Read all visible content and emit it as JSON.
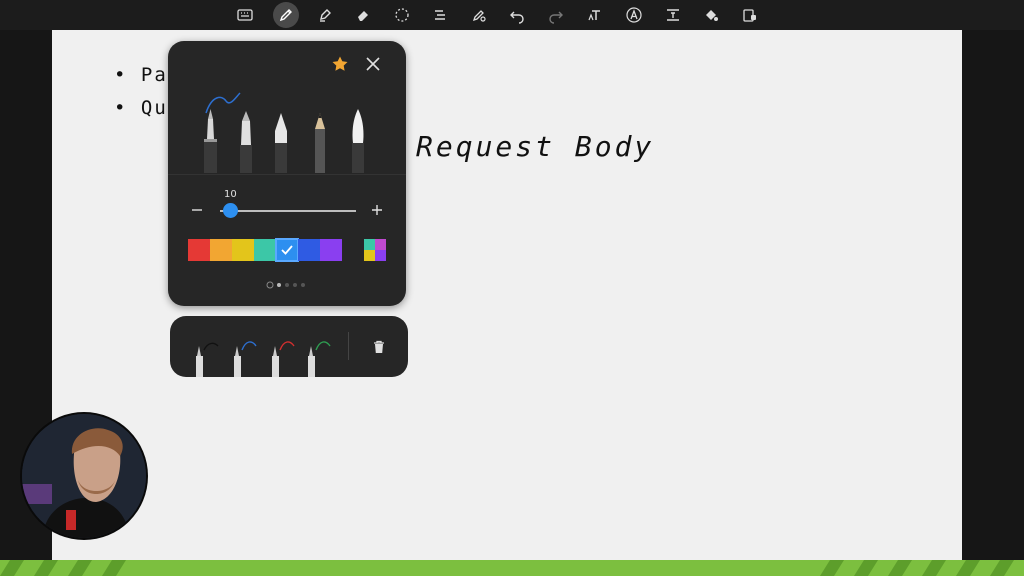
{
  "toolbar": {
    "tools": [
      {
        "name": "keyboard-icon"
      },
      {
        "name": "pen-icon",
        "active": true
      },
      {
        "name": "highlighter-icon"
      },
      {
        "name": "eraser-icon"
      },
      {
        "name": "lasso-icon"
      },
      {
        "name": "shape-recognition-icon"
      },
      {
        "name": "pen-to-shape-icon"
      },
      {
        "name": "undo-icon"
      },
      {
        "name": "redo-icon"
      },
      {
        "name": "text-tool-icon"
      },
      {
        "name": "text-style-icon"
      },
      {
        "name": "text-box-icon"
      },
      {
        "name": "fill-icon"
      },
      {
        "name": "lock-icon"
      }
    ]
  },
  "canvas": {
    "bullets": [
      "• Pat",
      "• Que"
    ],
    "heading": "Request Body"
  },
  "pen_popup": {
    "size_value": "10",
    "size_fraction": 0.08,
    "pens": [
      "fountain-pen",
      "calligraphy-pen",
      "ballpoint-pen",
      "pencil",
      "brush-pen"
    ],
    "selected_pen": "fountain-pen",
    "colors": [
      "#e53935",
      "#f2a632",
      "#e3c51b",
      "#3cc7a7",
      "#2d8ff0",
      "#2f5be3",
      "#8a3ff0"
    ],
    "selected_color": "#2d8ff0",
    "page_count": 4,
    "current_page": 0
  },
  "pen_bar": {
    "favorites": [
      {
        "pen": "fountain-pen",
        "color": "#111111"
      },
      {
        "pen": "fountain-pen",
        "color": "#2d6fd0"
      },
      {
        "pen": "fountain-pen",
        "color": "#d32f2f"
      },
      {
        "pen": "fountain-pen",
        "color": "#2e9e52"
      }
    ]
  },
  "colors": {
    "toolbar_bg": "#1c1c1c",
    "canvas_bg": "#f0f0f0",
    "popup_bg": "#262626",
    "accent": "#2d8ff0",
    "star": "#f2a632",
    "band": "#7cbf3f"
  }
}
